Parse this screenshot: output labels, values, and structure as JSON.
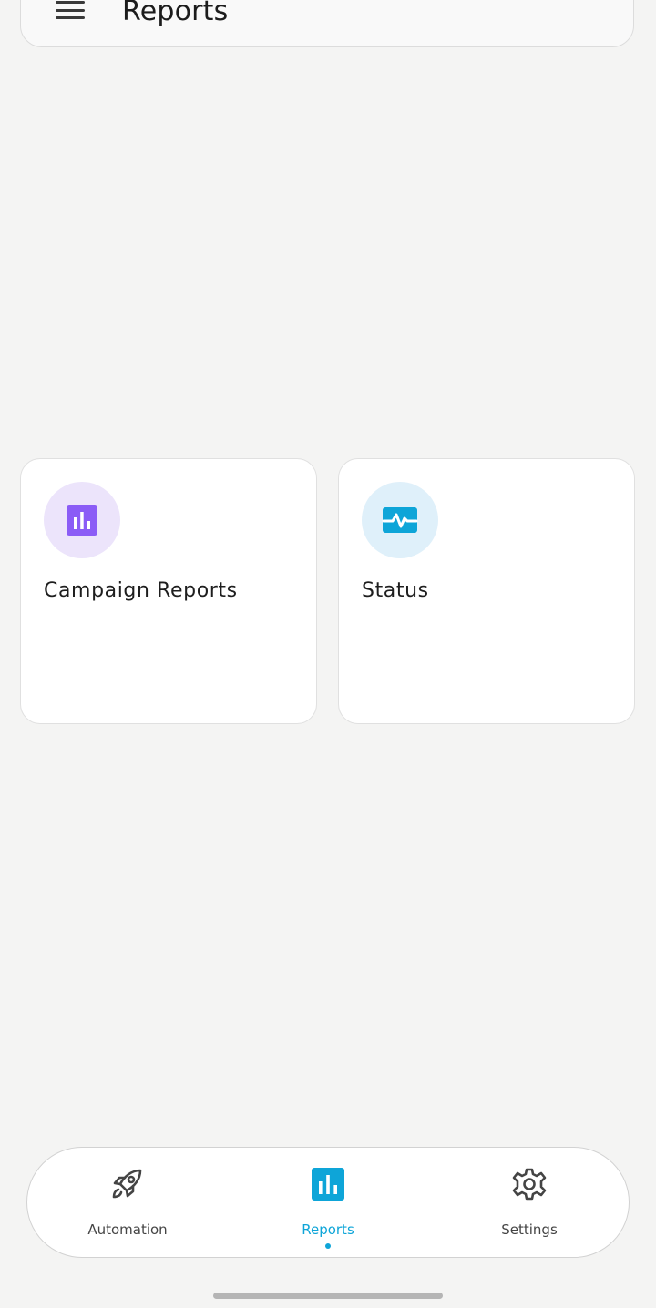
{
  "header": {
    "title": "Reports",
    "menu_icon": "hamburger-menu-icon"
  },
  "cards": [
    {
      "label": "Campaign Reports",
      "icon": "bar-chart-icon",
      "icon_color": "#8b5cf6",
      "icon_bg": "#ece4fb"
    },
    {
      "label": "Status",
      "icon": "pulse-monitor-icon",
      "icon_color": "#0ea5d8",
      "icon_bg": "#dff0fa"
    }
  ],
  "bottom_nav": {
    "items": [
      {
        "label": "Automation",
        "icon": "rocket-icon",
        "active": false
      },
      {
        "label": "Reports",
        "icon": "bar-chart-icon",
        "active": true
      },
      {
        "label": "Settings",
        "icon": "gear-icon",
        "active": false
      }
    ],
    "active_color": "#0ea5d8"
  }
}
